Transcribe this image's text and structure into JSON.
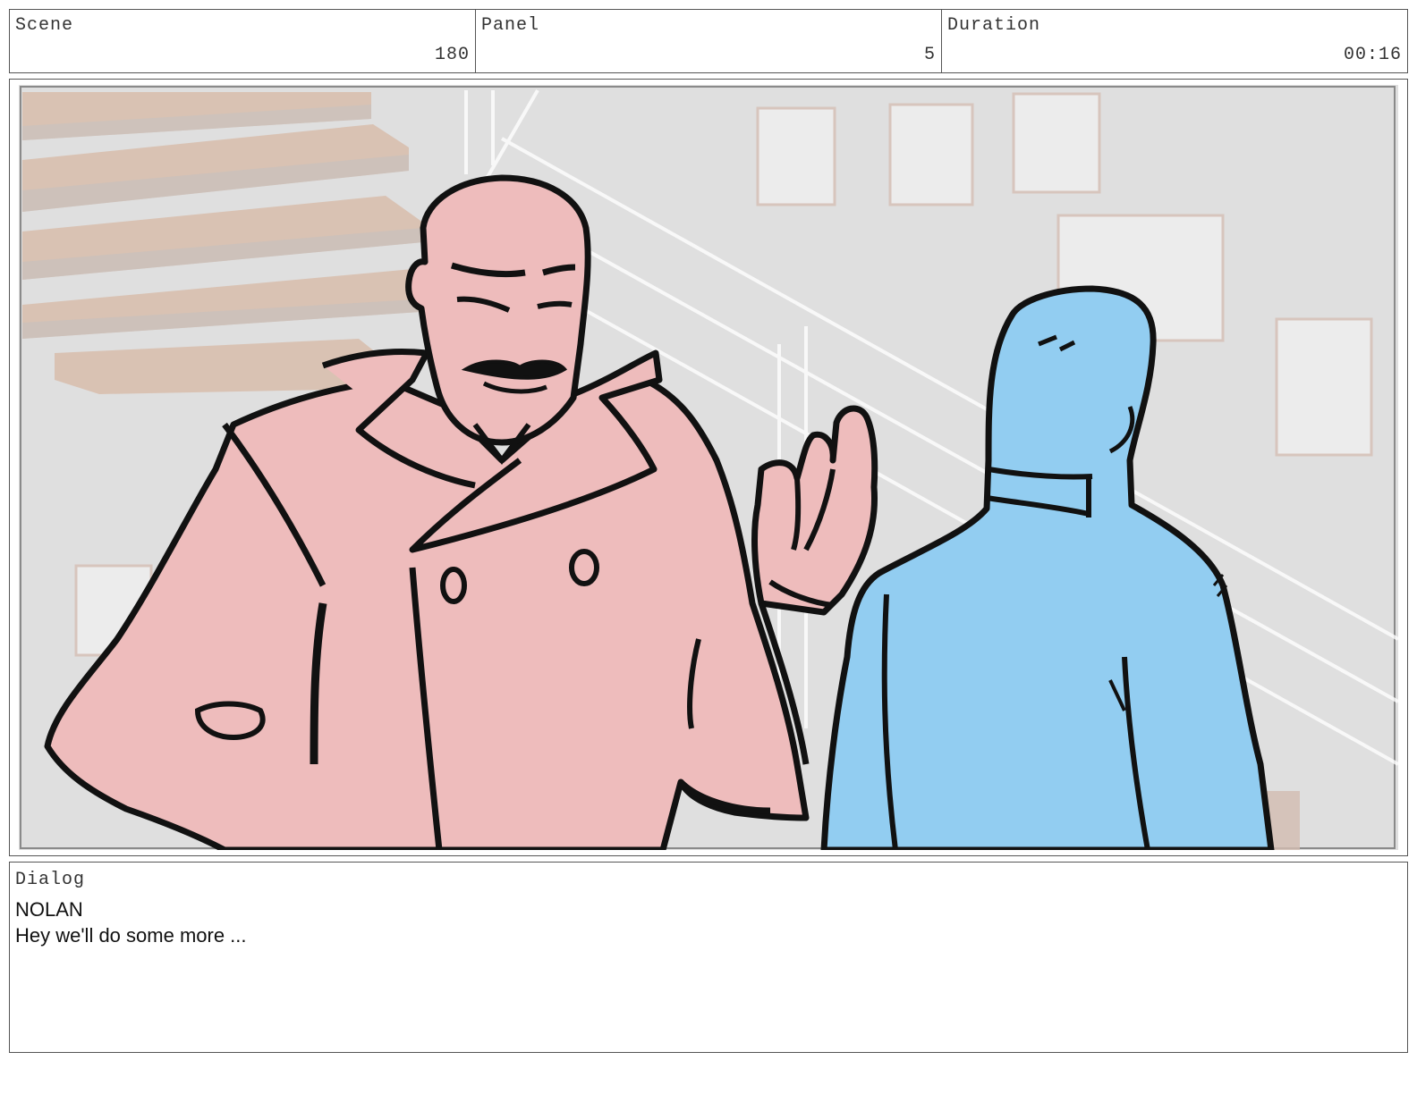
{
  "header": {
    "scene": {
      "label": "Scene",
      "value": "180"
    },
    "panel": {
      "label": "Panel",
      "value": "5"
    },
    "duration": {
      "label": "Duration",
      "value": "00:16"
    }
  },
  "dialog": {
    "label": "Dialog",
    "speaker": "NOLAN",
    "line": "Hey we'll do some more ..."
  },
  "colors": {
    "coat_fill": "#eebcbc",
    "figure_blue": "#92cdf1",
    "background_wall": "#dcdcdc",
    "stair_wood": "#d9c2b3",
    "ink": "#111111"
  }
}
